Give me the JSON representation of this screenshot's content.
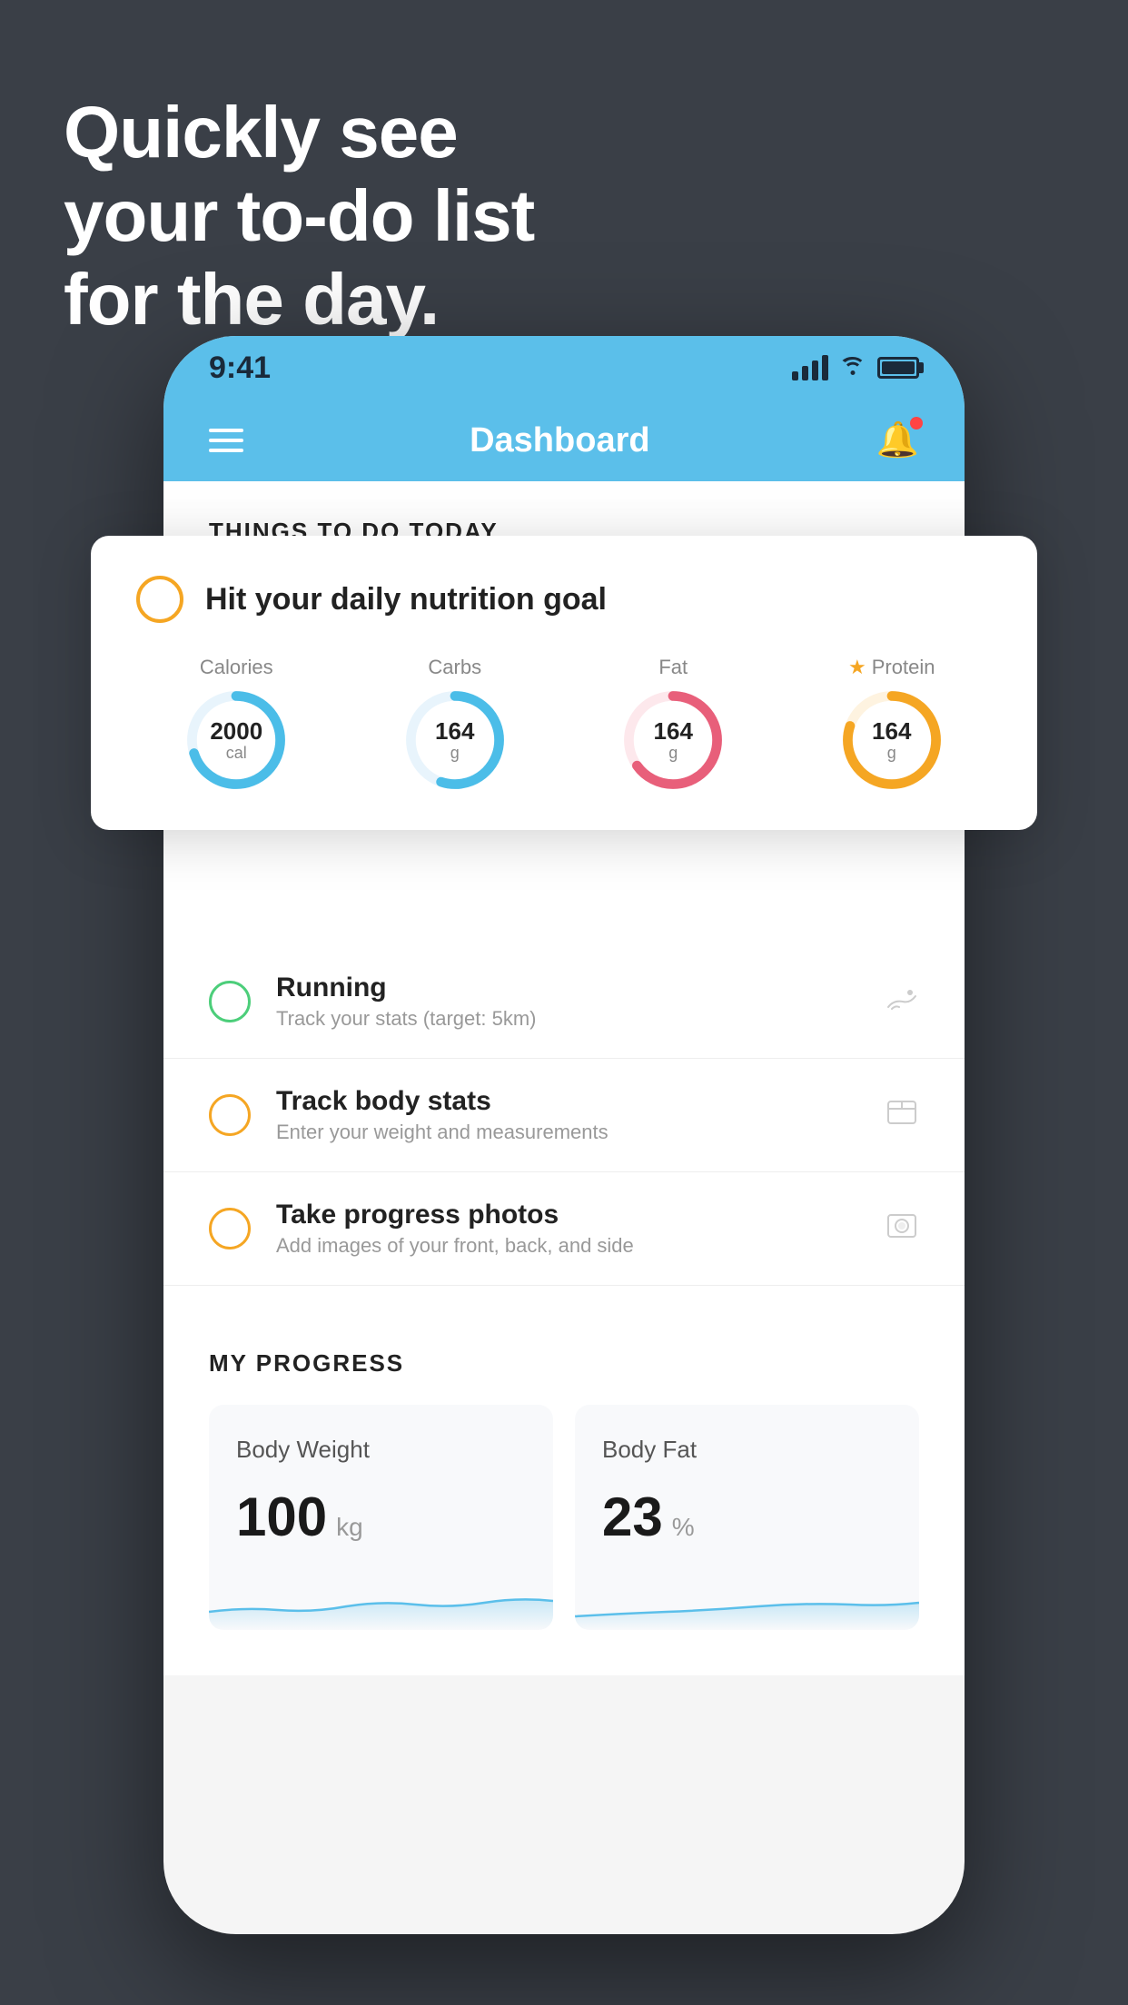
{
  "headline": {
    "line1": "Quickly see",
    "line2": "your to-do list",
    "line3": "for the day."
  },
  "status_bar": {
    "time": "9:41",
    "signal_label": "signal",
    "wifi_label": "wifi",
    "battery_label": "battery"
  },
  "nav": {
    "title": "Dashboard",
    "menu_label": "hamburger-menu",
    "bell_label": "notification-bell"
  },
  "things_today": {
    "section_title": "THINGS TO DO TODAY"
  },
  "floating_card": {
    "title": "Hit your daily nutrition goal",
    "items": [
      {
        "label": "Calories",
        "value": "2000",
        "unit": "cal",
        "color": "#4bbde8",
        "pct": 70
      },
      {
        "label": "Carbs",
        "value": "164",
        "unit": "g",
        "color": "#4bbde8",
        "pct": 55
      },
      {
        "label": "Fat",
        "value": "164",
        "unit": "g",
        "color": "#e85f7a",
        "pct": 65
      },
      {
        "label": "Protein",
        "value": "164",
        "unit": "g",
        "color": "#f5a623",
        "pct": 80,
        "starred": true
      }
    ]
  },
  "todo_items": [
    {
      "title": "Running",
      "subtitle": "Track your stats (target: 5km)",
      "circle_color": "green",
      "icon": "👟"
    },
    {
      "title": "Track body stats",
      "subtitle": "Enter your weight and measurements",
      "circle_color": "yellow",
      "icon": "⚖️"
    },
    {
      "title": "Take progress photos",
      "subtitle": "Add images of your front, back, and side",
      "circle_color": "yellow",
      "icon": "🧑"
    }
  ],
  "progress": {
    "section_title": "MY PROGRESS",
    "cards": [
      {
        "title": "Body Weight",
        "value": "100",
        "unit": "kg"
      },
      {
        "title": "Body Fat",
        "value": "23",
        "unit": "%"
      }
    ]
  }
}
